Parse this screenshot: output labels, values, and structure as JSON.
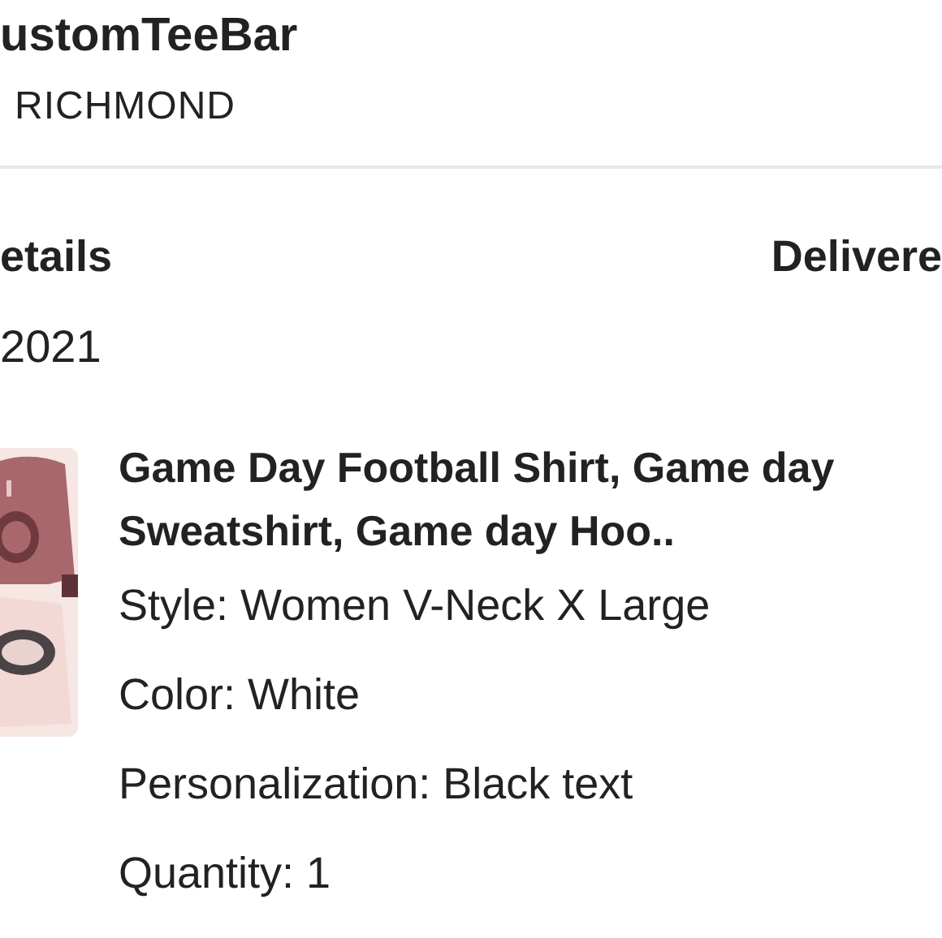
{
  "shop": {
    "name": "ustomTeeBar",
    "location": "RICHMOND"
  },
  "order": {
    "heading": "etails",
    "date": "2021",
    "status": "Delivere"
  },
  "item": {
    "title": "Game Day Football Shirt, Game day Sweatshirt, Game day Hoo..",
    "details": [
      "Style: Women V-Neck X Large",
      "Color: White",
      "Personalization: Black text",
      "Quantity: 1"
    ]
  }
}
